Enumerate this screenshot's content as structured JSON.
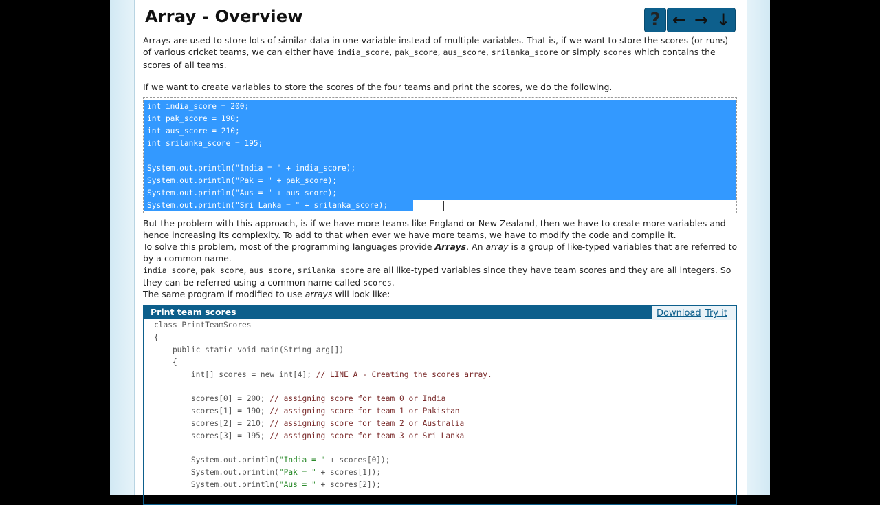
{
  "page": {
    "title": "Array - Overview",
    "nav": {
      "help": "?",
      "prev": "←",
      "next": "→",
      "down": "↓"
    }
  },
  "intro": {
    "p1": {
      "a": "Arrays are used to store lots of similar data in one variable instead of multiple variables. That is, if we want to store the scores (or runs) of various cricket teams, we can either have ",
      "c1": "india_score",
      "s1": ", ",
      "c2": "pak_score",
      "s2": ", ",
      "c3": "aus_score",
      "s3": ", ",
      "c4": "srilanka_score",
      "s4": " or simply ",
      "c5": "scores",
      "s5": " which contains the scores of all teams."
    },
    "p2": "If we want to create variables to store the scores of the four teams and print the scores, we do the following."
  },
  "snippet": {
    "lines": [
      "int india_score = 200;",
      "int pak_score = 190;",
      "int aus_score = 210;",
      "int srilanka_score = 195;",
      "",
      "System.out.println(\"India = \" + india_score);",
      "System.out.println(\"Pak = \" + pak_score);",
      "System.out.println(\"Aus = \" + aus_score);",
      "System.out.println(\"Sri Lanka = \" + srilanka_score);"
    ]
  },
  "explain": {
    "p3": "But the problem with this approach, is if we have more teams like England or New Zealand, then we have to create more variables and hence increasing its complexity. To add to that when ever we have more teams, we have to modify the code and compile it.",
    "p4a": "To solve this problem, most of the programming languages provide ",
    "p4b": "Arrays",
    "p4c": ". An ",
    "p4d": "array",
    "p4e": " is a group of like-typed variables that are referred to by a common name.",
    "p5c1": "india_score",
    "p5s1": ", ",
    "p5c2": "pak_score",
    "p5s2": ", ",
    "p5c3": "aus_score",
    "p5s3": ", ",
    "p5c4": "srilanka_score",
    "p5s4": " are all like-typed variables since they have team scores and they are all integers. So they can be referred using a common name called ",
    "p5c5": "scores",
    "p5s5": ".",
    "p6a": "The same program if modified to use ",
    "p6b": "arrays",
    "p6c": " will look like:"
  },
  "program": {
    "title": "Print team scores",
    "download": "Download",
    "tryit": "Try it",
    "lines": [
      "class PrintTeamScores",
      "{",
      "    public static void main(String arg[])",
      "    {",
      "        int[] scores = new int[4]; // LINE A - Creating the scores array.",
      "",
      "        scores[0] = 200; // assigning score for team 0 or India",
      "        scores[1] = 190; // assigning score for team 1 or Pakistan",
      "        scores[2] = 210; // assigning score for team 2 or Australia",
      "        scores[3] = 195; // assigning score for team 3 or Sri Lanka",
      "",
      "        System.out.println(\"India = \" + scores[0]);",
      "        System.out.println(\"Pak = \" + scores[1]);",
      "        System.out.println(\"Aus = \" + scores[2]);"
    ]
  }
}
